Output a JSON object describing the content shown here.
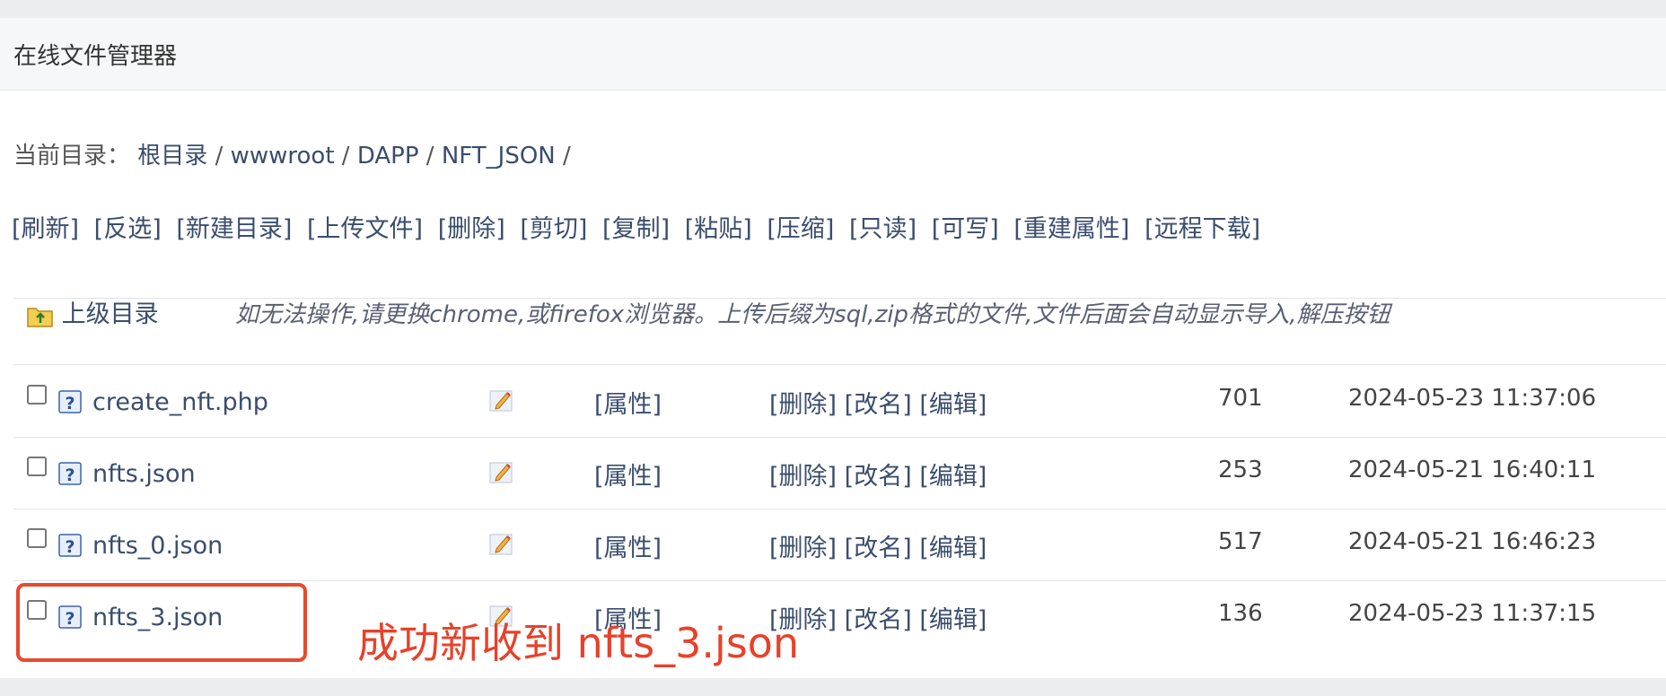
{
  "app": {
    "title": "在线文件管理器"
  },
  "breadcrumb": {
    "prefix": "当前目录：",
    "items": [
      "根目录",
      "wwwroot",
      "DAPP",
      "NFT_JSON"
    ],
    "separator": "/"
  },
  "toolbar": {
    "buttons": [
      "[刷新]",
      "[反选]",
      "[新建目录]",
      "[上传文件]",
      "[删除]",
      "[剪切]",
      "[复制]",
      "[粘贴]",
      "[压缩]",
      "[只读]",
      "[可写]",
      "[重建属性]",
      "[远程下载]"
    ]
  },
  "parent_dir": {
    "label": "上级目录",
    "icon": "folder-up-icon"
  },
  "notice": "如无法操作,请更换chrome,或firefox浏览器。上传后缀为sql,zip格式的文件,文件后面会自动显示导入,解压按钮",
  "file_actions": {
    "attr": "[属性]",
    "delete": "[删除]",
    "rename": "[改名]",
    "edit": "[编辑]"
  },
  "files": [
    {
      "name": "create_nft.php",
      "size": "701",
      "mtime": "2024-05-23 11:37:06",
      "checked": false
    },
    {
      "name": "nfts.json",
      "size": "253",
      "mtime": "2024-05-21 16:40:11",
      "checked": false
    },
    {
      "name": "nfts_0.json",
      "size": "517",
      "mtime": "2024-05-21 16:46:23",
      "checked": false
    },
    {
      "name": "nfts_3.json",
      "size": "136",
      "mtime": "2024-05-23 11:37:15",
      "checked": false
    }
  ],
  "annotation": {
    "text": "成功新收到 nfts_3.json",
    "color": "#e8412a"
  },
  "colors": {
    "link": "#3a4d6c",
    "background": "#ebedf0",
    "panel": "#ffffff",
    "header": "#f6f7f8",
    "highlight": "#e84a2e"
  }
}
